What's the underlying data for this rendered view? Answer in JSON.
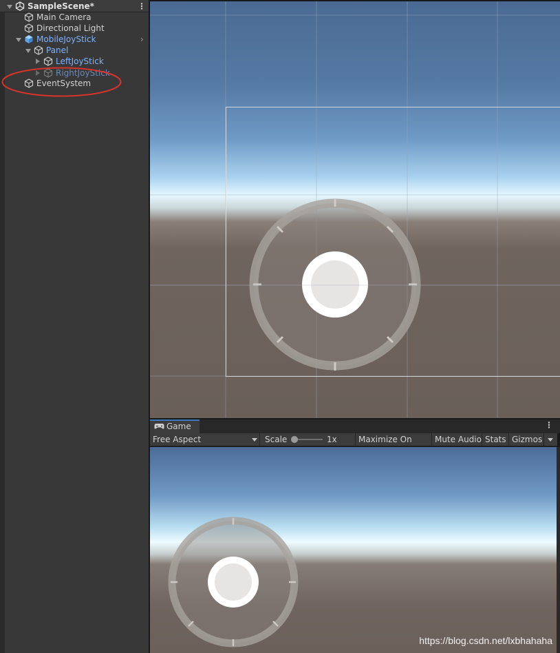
{
  "hierarchy": {
    "scene_name": "SampleScene*",
    "items": [
      {
        "label": "Main Camera"
      },
      {
        "label": "Directional Light"
      },
      {
        "label": "MobileJoyStick"
      },
      {
        "label": "Panel"
      },
      {
        "label": "LeftJoyStick"
      },
      {
        "label": "RightJoyStick"
      },
      {
        "label": "EventSystem"
      }
    ]
  },
  "game": {
    "tab_label": "Game",
    "aspect": "Free Aspect",
    "scale_label": "Scale",
    "scale_value": "1x",
    "maximize_on_play": "Maximize On Play",
    "mute_audio": "Mute Audio",
    "stats": "Stats",
    "gizmos": "Gizmos",
    "watermark": "https://blog.csdn.net/lxbhahaha"
  },
  "colors": {
    "selection_blue": "#7fb2ff",
    "annotation_red": "#d9342b",
    "tab_accent": "#3a79bb"
  }
}
